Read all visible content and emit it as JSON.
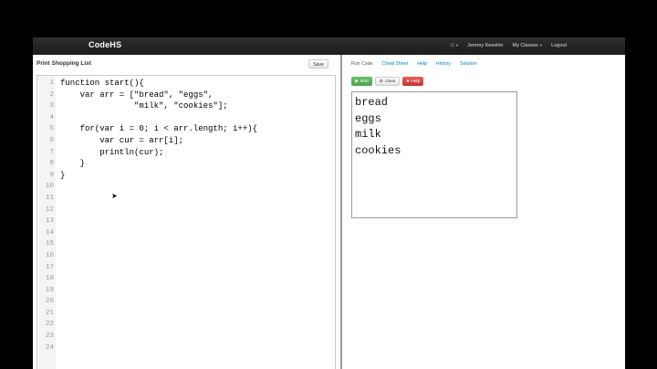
{
  "navbar": {
    "brand": "CodeHS",
    "user": "Jeremy Keeshin",
    "classes": "My Classes",
    "logout": "Logout"
  },
  "editor": {
    "title": "Print Shopping List",
    "save_label": "Save",
    "lines": [
      "function start(){",
      "    var arr = [\"bread\", \"eggs\",",
      "               \"milk\", \"cookies\"];",
      "",
      "    for(var i = 0; i < arr.length; i++){",
      "        var cur = arr[i];",
      "        println(cur);",
      "    }",
      "}",
      "",
      "",
      "",
      "",
      "",
      "",
      "",
      "",
      "",
      "",
      "",
      "",
      "",
      "",
      ""
    ]
  },
  "right": {
    "tabs": [
      "Run Code",
      "Cheat Sheet",
      "Help",
      "History",
      "Solution"
    ],
    "run_label": "Run",
    "clear_label": "Clear",
    "help_label": "Help",
    "output": [
      "bread",
      "eggs",
      "milk",
      "cookies"
    ]
  }
}
